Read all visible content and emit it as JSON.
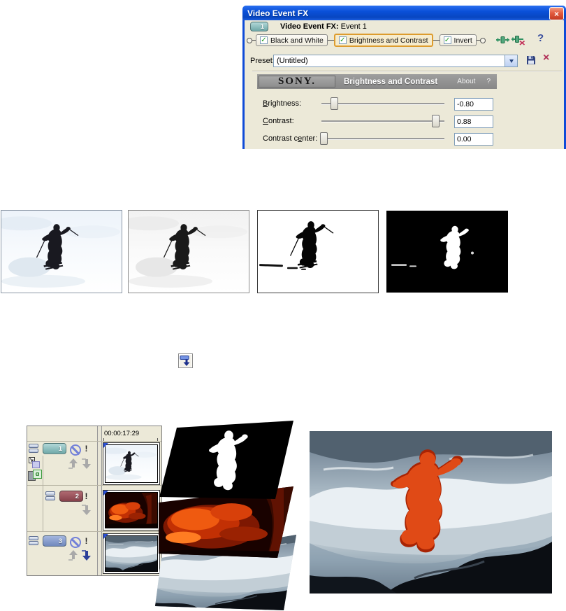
{
  "window": {
    "title": "Video Event FX"
  },
  "icons": {
    "close": "×",
    "delete": "×",
    "check": "✓"
  },
  "event_header": {
    "chip": "1",
    "prefix": "Video Event FX:",
    "event": "Event 1"
  },
  "plugin_chain": {
    "plugins": [
      {
        "label": "Black and White"
      },
      {
        "label": "Brightness and Contrast"
      },
      {
        "label": "Invert"
      }
    ],
    "help": "?"
  },
  "preset": {
    "label": "Preset:",
    "value": "(Untitled)"
  },
  "fx_bar": {
    "brand": "SONY.",
    "title": "Brightness and Contrast",
    "about": "About",
    "help": "?"
  },
  "sliders": [
    {
      "pre": "",
      "key": "B",
      "post": "rightness:",
      "value": "-0.80"
    },
    {
      "pre": "",
      "key": "C",
      "post": "ontrast:",
      "value": "0.88"
    },
    {
      "pre": "Contrast c",
      "key": "e",
      "post": "nter:",
      "value": "0.00"
    }
  ],
  "timeline": {
    "timecode": "00:00:17:29",
    "tracks": [
      {
        "number": "1"
      },
      {
        "number": "2"
      },
      {
        "number": "3"
      }
    ],
    "solo": "!",
    "alpha": "α"
  },
  "colors": {
    "titlebar_blue": "#0a50d8",
    "active_plugin_border": "#dd9c2e",
    "track1_chip": "#7fb8b8",
    "track2_chip": "#9a525a",
    "track3_chip": "#8094c8",
    "lava_orange": "#e84a10",
    "composite_red": "#d8380e"
  }
}
